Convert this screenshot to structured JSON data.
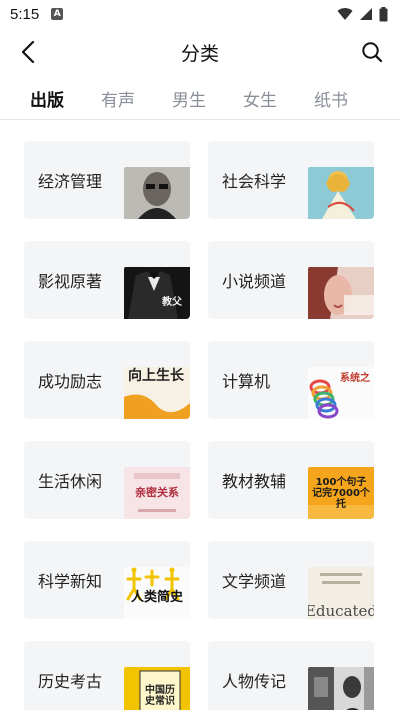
{
  "status_bar": {
    "time": "5:15",
    "notification_badge": "A"
  },
  "header": {
    "title": "分类"
  },
  "tabs": [
    {
      "label": "出版",
      "active": true
    },
    {
      "label": "有声",
      "active": false
    },
    {
      "label": "男生",
      "active": false
    },
    {
      "label": "女生",
      "active": false
    },
    {
      "label": "纸书",
      "active": false
    }
  ],
  "categories": [
    {
      "label": "经济管理",
      "cover_icon": "portrait-photo"
    },
    {
      "label": "社会科学",
      "cover_icon": "illustrated-girl"
    },
    {
      "label": "影视原著",
      "cover_icon": "tuxedo-figure",
      "cover_text": "教父"
    },
    {
      "label": "小说频道",
      "cover_icon": "woman-face"
    },
    {
      "label": "成功励志",
      "cover_icon": "text-cover",
      "cover_text": "向上生长"
    },
    {
      "label": "计算机",
      "cover_icon": "rainbow-spring",
      "cover_text": "系统之"
    },
    {
      "label": "生活休闲",
      "cover_icon": "text-cover",
      "cover_text": "亲密关系"
    },
    {
      "label": "教材教辅",
      "cover_icon": "text-cover",
      "cover_text": "100个句子 记完7000个托"
    },
    {
      "label": "科学新知",
      "cover_icon": "dancing-figures",
      "cover_text": "人类简史"
    },
    {
      "label": "文学频道",
      "cover_icon": "text-cover",
      "cover_text": "Educated"
    },
    {
      "label": "历史考古",
      "cover_icon": "text-cover",
      "cover_text": "中国历史常识"
    },
    {
      "label": "人物传记",
      "cover_icon": "bw-photo"
    }
  ],
  "colors": {
    "accent": "#111111",
    "inactive_tab": "#8a8f99",
    "card_bg": "#f4f5f7"
  }
}
